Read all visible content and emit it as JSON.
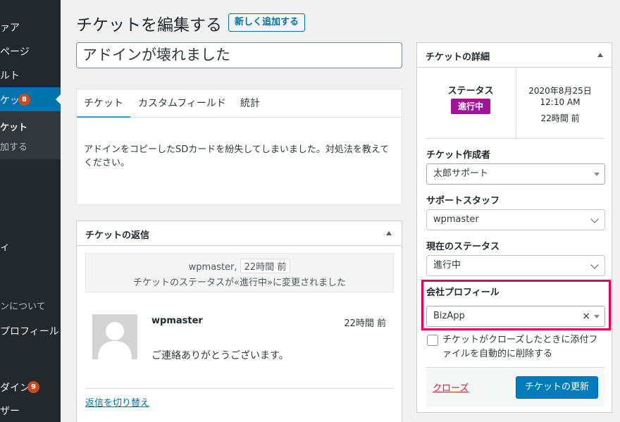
{
  "sidebar": {
    "items": [
      {
        "label": "ァア"
      },
      {
        "label": "ページ"
      },
      {
        "label": "ルト"
      },
      {
        "label": "ケット",
        "badge": "8"
      },
      {
        "label": "ケット"
      },
      {
        "label": "加する"
      },
      {
        "label": "ィ"
      },
      {
        "label": "ンについて"
      },
      {
        "label": "プロフィール"
      },
      {
        "label": "ダイン",
        "badge": "9"
      },
      {
        "label": "ザー"
      }
    ]
  },
  "header": {
    "title": "チケットを編集する",
    "add_new": "新しく追加する"
  },
  "ticket": {
    "title": "アドインが壊れました",
    "tabs": [
      "チケット",
      "カスタムフィールド",
      "統計"
    ],
    "body": "アドインをコピーしたSDカードを紛失してしまいました。対処法を教えてください。"
  },
  "replies": {
    "heading": "チケットの返信",
    "status_note": {
      "author": "wpmaster,",
      "time": "22時間 前",
      "message": "チケットのステータスが«進行中»に変更されました"
    },
    "reply": {
      "author": "wpmaster",
      "time": "22時間 前",
      "text": "ご連絡ありがとうございます。"
    },
    "toggle_label": "返信を切り替え"
  },
  "details": {
    "heading": "チケットの詳細",
    "status_label": "ステータス",
    "status_value": "進行中",
    "status_color": "#a01497",
    "date": "2020年8月25日",
    "time": "12:10 AM",
    "relative": "22時間 前",
    "author_label": "チケット作成者",
    "author_value": "太郎サポート",
    "staff_label": "サポートスタッフ",
    "staff_value": "wpmaster",
    "current_status_label": "現在のステータス",
    "current_status_value": "進行中",
    "company_label": "会社プロフィール",
    "company_value": "BizApp",
    "clear_symbol": "×",
    "delete_attachments_label": "チケットがクローズしたときに添付ファイルを自動的に削除する",
    "close_label": "クローズ",
    "update_label": "チケットの更新"
  },
  "colors": {
    "sidebar_bg": "#23282d",
    "accent": "#0073aa",
    "badge": "#ca4a1f",
    "highlight": "#e8005a"
  }
}
